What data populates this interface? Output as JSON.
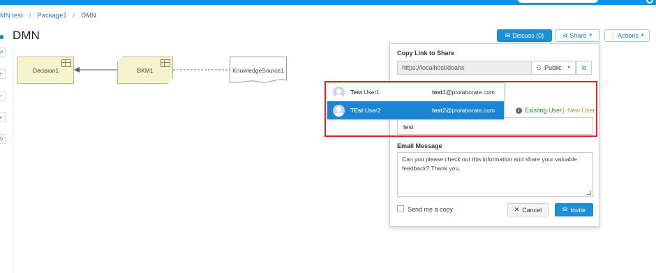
{
  "breadcrumb": [
    "MN test",
    "Package1",
    "DMN"
  ],
  "page_title": "DMN",
  "header_buttons": {
    "discuss": "Discuss (0)",
    "share": "Share",
    "actions": "Actions"
  },
  "diagram": {
    "decision": "Decision1",
    "bkm": "BKM1",
    "knowledge_source": "KnowledgeSource1"
  },
  "share_panel": {
    "copy_link_label": "Copy Link to Share",
    "link_value": "https://localhost/doahs",
    "permission": "Public",
    "existing_user": "Existing User",
    "separator": "|",
    "new_user": "New User",
    "user_input_value": "test",
    "email_message_label": "Email Message",
    "email_message_value": "Can you please check out this information and share your valuable feedback? Thank you.",
    "send_me_copy": "Send me a copy",
    "cancel": "Cancel",
    "invite": "Invite"
  },
  "suggestions": [
    {
      "name_bold": "Test",
      "name_rest": " User1",
      "email_bold": "test",
      "email_rest": "1@prolaborate.com"
    },
    {
      "name_bold": "TEst",
      "name_rest": " User2",
      "email_bold": "test",
      "email_rest": "2@prolaborate.com"
    }
  ],
  "colors": {
    "primary": "#1b90d8",
    "highlight_border": "#e0232a",
    "existing_user": "#2c8a2c",
    "new_user": "#e98b1f",
    "node_fill": "#f7f3cf"
  },
  "icons": {
    "discuss": "comments-icon",
    "share": "share-icon",
    "actions": "ellipsis-icon",
    "permission": "users-icon",
    "copy": "copy-icon",
    "info": "info-icon",
    "cancel": "times-icon",
    "invite": "envelope-icon"
  }
}
